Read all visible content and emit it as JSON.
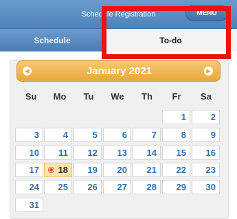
{
  "header": {
    "title": "Schedule Registration",
    "menu_label": "MENU"
  },
  "tabs": [
    {
      "label": "Schedule"
    },
    {
      "label": "To-do"
    }
  ],
  "calendar": {
    "month_title": "January 2021",
    "prev_icon": "chevron-left-icon",
    "next_icon": "chevron-right-icon",
    "weekdays": [
      "Su",
      "Mo",
      "Tu",
      "We",
      "Th",
      "Fr",
      "Sa"
    ],
    "weeks": [
      [
        "",
        "",
        "",
        "",
        "",
        "1",
        "2"
      ],
      [
        "3",
        "4",
        "5",
        "6",
        "7",
        "8",
        "9"
      ],
      [
        "10",
        "11",
        "12",
        "13",
        "14",
        "15",
        "16"
      ],
      [
        "17",
        "18",
        "19",
        "20",
        "21",
        "22",
        "23"
      ],
      [
        "24",
        "25",
        "26",
        "27",
        "28",
        "29",
        "30"
      ],
      [
        "31",
        "",
        "",
        "",
        "",
        "",
        ""
      ]
    ],
    "today": "18"
  },
  "colors": {
    "accent_blue": "#4f82ba",
    "header_orange": "#e9a83a",
    "highlight_red": "#ee1111",
    "today_bg": "#fbe6a6"
  }
}
